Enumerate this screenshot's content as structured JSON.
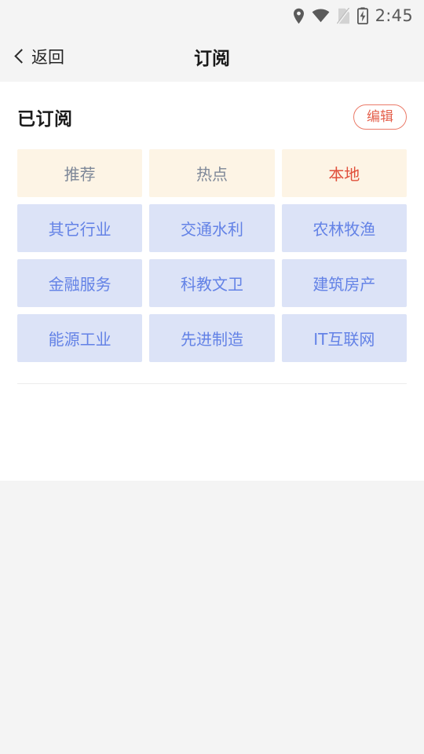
{
  "status_bar": {
    "icons": [
      "location-pin-icon",
      "wifi-icon",
      "sim-card-off-icon",
      "battery-charging-icon"
    ],
    "time": "2:45"
  },
  "nav": {
    "back_label": "返回",
    "back_icon": "chevron-left-icon",
    "title": "订阅"
  },
  "section": {
    "title": "已订阅",
    "edit_label": "编辑"
  },
  "colors": {
    "fixed_tile_bg": "#fdf4e5",
    "fixed_tile_text": "#7d8798",
    "active_tile_text": "#e0503b",
    "category_tile_bg": "#dce3f7",
    "category_tile_text": "#6382e6",
    "edit_border": "#eb7a68",
    "edit_text": "#e4604c",
    "page_bg": "#f4f4f4",
    "card_bg": "#ffffff"
  },
  "tiles": {
    "rows": [
      [
        {
          "label": "推荐",
          "kind": "fixed",
          "active": false
        },
        {
          "label": "热点",
          "kind": "fixed",
          "active": false
        },
        {
          "label": "本地",
          "kind": "fixed",
          "active": true
        }
      ],
      [
        {
          "label": "其它行业",
          "kind": "cat",
          "active": false
        },
        {
          "label": "交通水利",
          "kind": "cat",
          "active": false
        },
        {
          "label": "农林牧渔",
          "kind": "cat",
          "active": false
        }
      ],
      [
        {
          "label": "金融服务",
          "kind": "cat",
          "active": false
        },
        {
          "label": "科教文卫",
          "kind": "cat",
          "active": false
        },
        {
          "label": "建筑房产",
          "kind": "cat",
          "active": false
        }
      ],
      [
        {
          "label": "能源工业",
          "kind": "cat",
          "active": false
        },
        {
          "label": "先进制造",
          "kind": "cat",
          "active": false
        },
        {
          "label": "IT互联网",
          "kind": "cat",
          "active": false
        }
      ]
    ]
  }
}
